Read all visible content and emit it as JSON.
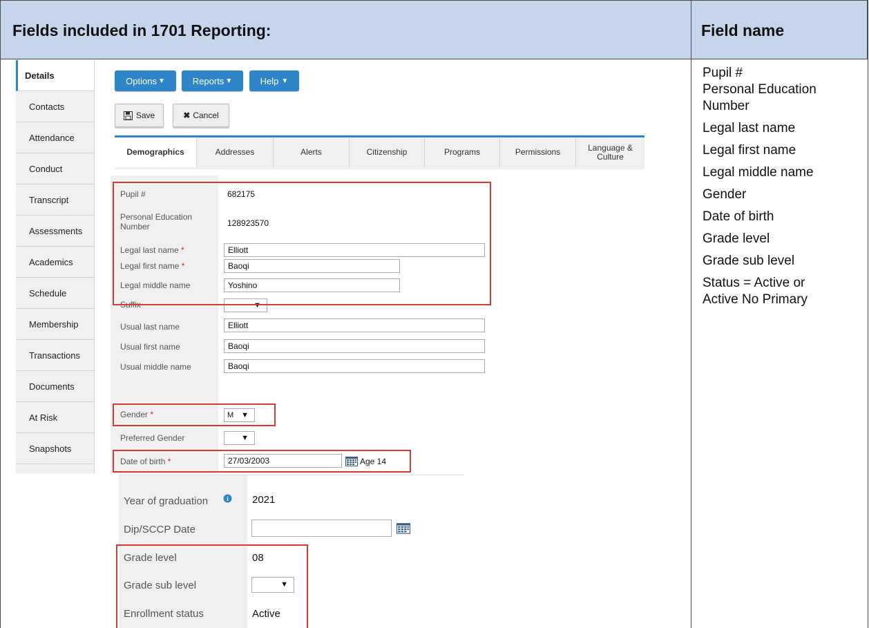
{
  "header": {
    "left_title": "Fields included in 1701 Reporting:",
    "right_title": "Field name"
  },
  "field_names": [
    "Pupil #",
    "Personal Education",
    "Number",
    "Legal last name",
    "Legal first name",
    "Legal middle name",
    "Gender",
    "Date of birth",
    "Grade level",
    "Grade sub level",
    "Status = Active or",
    "Active No Primary"
  ],
  "sidebar": {
    "items": [
      {
        "label": "Details"
      },
      {
        "label": "Contacts"
      },
      {
        "label": "Attendance"
      },
      {
        "label": "Conduct"
      },
      {
        "label": "Transcript"
      },
      {
        "label": "Assessments"
      },
      {
        "label": "Academics"
      },
      {
        "label": "Schedule"
      },
      {
        "label": "Membership"
      },
      {
        "label": "Transactions"
      },
      {
        "label": "Documents"
      },
      {
        "label": "At Risk"
      },
      {
        "label": "Snapshots"
      }
    ]
  },
  "toolbar": {
    "options_label": "Options",
    "reports_label": "Reports",
    "help_label": "Help",
    "save_label": "Save",
    "cancel_label": "Cancel"
  },
  "tabs": [
    {
      "label": "Demographics"
    },
    {
      "label": "Addresses"
    },
    {
      "label": "Alerts"
    },
    {
      "label": "Citizenship"
    },
    {
      "label": "Programs"
    },
    {
      "label": "Permissions"
    },
    {
      "label": "Language & Culture"
    }
  ],
  "form": {
    "pupil_label": "Pupil #",
    "pupil_value": "682175",
    "pen_label": "Personal Education Number",
    "pen_value": "128923570",
    "legal_last_label": "Legal last name",
    "legal_last_value": "Elliott",
    "legal_first_label": "Legal first name",
    "legal_first_value": "Baoqi",
    "legal_middle_label": "Legal middle name",
    "legal_middle_value": "Yoshino",
    "suffix_label": "Suffix",
    "suffix_value": "",
    "usual_last_label": "Usual last name",
    "usual_last_value": "Elliott",
    "usual_first_label": "Usual first name",
    "usual_first_value": "Baoqi",
    "usual_middle_label": "Usual middle name",
    "usual_middle_value": "Baoqi",
    "gender_label": "Gender",
    "gender_value": "M",
    "pref_gender_label": "Preferred Gender",
    "pref_gender_value": "",
    "dob_label": "Date of birth",
    "dob_value": "27/03/2003",
    "age_text": "Age 14",
    "required_mark": "*"
  },
  "lower_form": {
    "grad_year_label": "Year of graduation",
    "grad_year_value": "2021",
    "dip_label": "Dip/SCCP Date",
    "dip_value": "",
    "grade_level_label": "Grade level",
    "grade_level_value": "08",
    "grade_sub_label": "Grade sub level",
    "grade_sub_value": "",
    "enroll_label": "Enrollment status",
    "enroll_value": "Active"
  },
  "colors": {
    "header_bg": "#c6d5ec",
    "primary_blue": "#2e86c9",
    "highlight_red": "#d43a36",
    "required_red": "#d9211c"
  },
  "icons": [
    "caret-down-icon",
    "save-icon",
    "close-icon",
    "calendar-icon",
    "info-icon"
  ]
}
